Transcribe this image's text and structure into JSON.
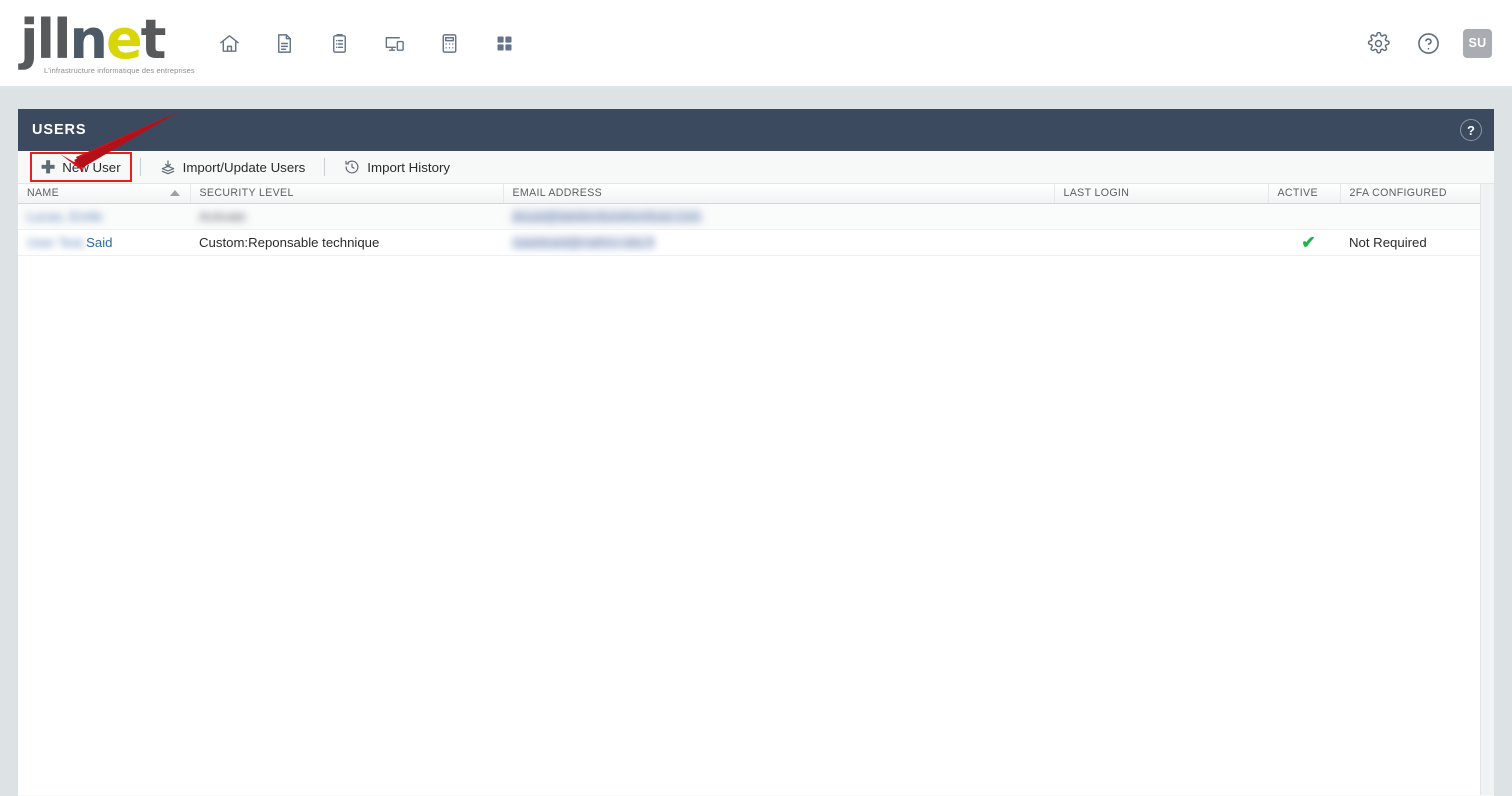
{
  "topbar": {
    "logo": {
      "part1": "jll",
      "part2": "n",
      "part3": "e",
      "part4": "t",
      "tagline": "L'infrastructure informatique des entreprises"
    },
    "nav_items": [
      {
        "name": "home-icon",
        "label": "Home"
      },
      {
        "name": "document-icon",
        "label": "Documents"
      },
      {
        "name": "clipboard-icon",
        "label": "Tickets"
      },
      {
        "name": "devices-icon",
        "label": "Devices"
      },
      {
        "name": "calculator-icon",
        "label": "Billing"
      },
      {
        "name": "grid-apps-icon",
        "label": "Apps"
      }
    ],
    "right_items": [
      {
        "name": "gear-icon",
        "label": "Settings"
      },
      {
        "name": "help-circle-icon",
        "label": "Help"
      }
    ],
    "avatar_initials": "SU"
  },
  "card": {
    "title": "USERS",
    "help_glyph": "?",
    "header_color": "#3c4a5f"
  },
  "toolbar": {
    "new_user_label": "New User",
    "new_user_icon": "plus-icon",
    "import_users_label": "Import/Update Users",
    "import_users_icon": "import-icon",
    "import_history_label": "Import History",
    "import_history_icon": "history-clock-icon",
    "highlight_color": "#e8201c"
  },
  "table": {
    "columns": [
      {
        "key": "name",
        "label": "NAME",
        "sorted": "asc"
      },
      {
        "key": "sec",
        "label": "SECURITY LEVEL",
        "sorted": ""
      },
      {
        "key": "mail",
        "label": "EMAIL ADDRESS",
        "sorted": ""
      },
      {
        "key": "login",
        "label": "LAST LOGIN",
        "sorted": ""
      },
      {
        "key": "active",
        "label": "ACTIVE",
        "sorted": ""
      },
      {
        "key": "twofa",
        "label": "2FA CONFIGURED",
        "sorted": ""
      }
    ],
    "rows": [
      {
        "name_redacted": "Lucas, Emile",
        "name_link": "",
        "security": "Activate",
        "email_redacted": "douai@latelierdunebonfuse.com",
        "last_login": "",
        "active": "",
        "twofa": "",
        "redacted": true
      },
      {
        "name_redacted": "User Test,",
        "name_link": "Said",
        "security": "Custom:Reponsable technique",
        "email_redacted": "saaidsaid@nathro-site.fr",
        "last_login": "",
        "active": "✔",
        "twofa": "Not Required",
        "redacted": false
      }
    ]
  }
}
